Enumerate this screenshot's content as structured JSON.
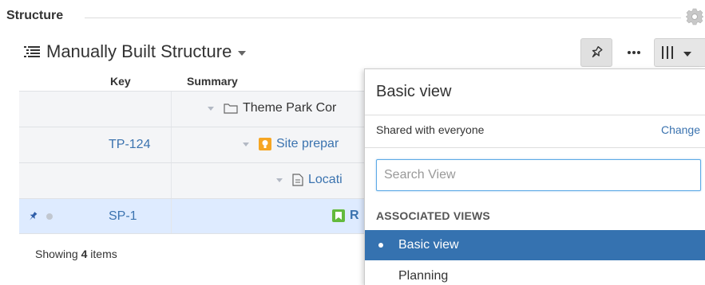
{
  "panel": {
    "title": "Structure"
  },
  "structure": {
    "name": "Manually Built Structure"
  },
  "grid": {
    "columns": {
      "key": "Key",
      "summary": "Summary"
    },
    "rows": [
      {
        "key": "",
        "summary": "Theme Park Cor",
        "icon": "folder-icon"
      },
      {
        "key": "TP-124",
        "summary": "Site prepar",
        "icon": "idea-icon"
      },
      {
        "key": "",
        "summary": "Locati",
        "icon": "document-icon"
      },
      {
        "key": "SP-1",
        "summary": "R",
        "icon": "story-icon"
      }
    ],
    "footer": {
      "prefix": "Showing ",
      "count": "4",
      "suffix": " items"
    }
  },
  "view_menu": {
    "title": "Basic view",
    "shared_text": "Shared with everyone",
    "change_label": "Change",
    "search_placeholder": "Search View",
    "section_label": "ASSOCIATED VIEWS",
    "items": [
      {
        "label": "Basic view",
        "active": true
      },
      {
        "label": "Planning",
        "active": false
      }
    ]
  },
  "colors": {
    "accent": "#3572b0",
    "link": "#3b73af",
    "selected_row": "#deebff"
  }
}
